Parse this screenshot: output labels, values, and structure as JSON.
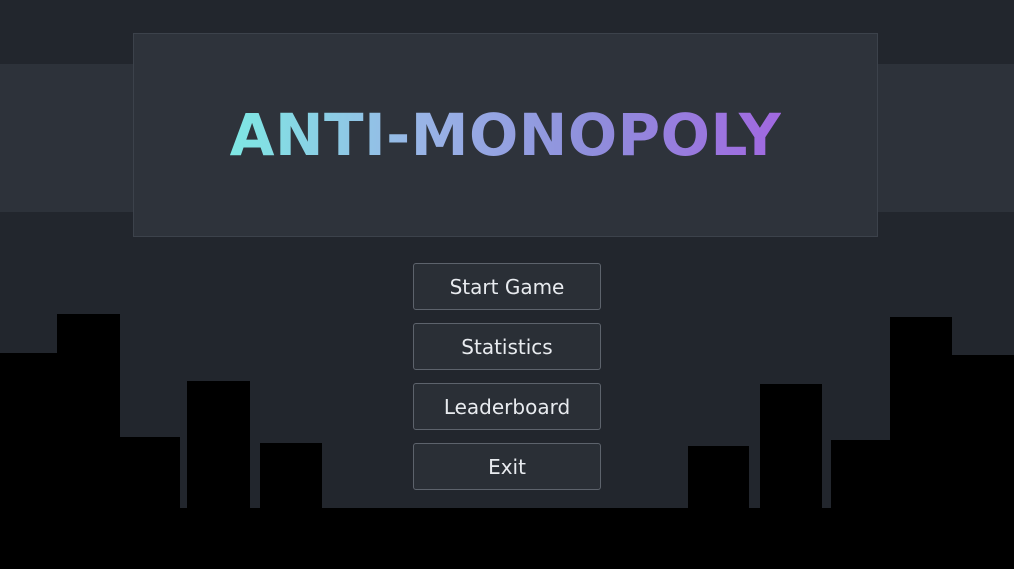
{
  "title": "ANTI-MONOPOLY",
  "menu": {
    "start_label": "Start Game",
    "statistics_label": "Statistics",
    "leaderboard_label": "Leaderboard",
    "exit_label": "Exit"
  },
  "colors": {
    "background": "#22262d",
    "band": "#2d323a",
    "panel": "#2e333b",
    "skyline": "#000000",
    "title_gradient_start": "#7ee8e4",
    "title_gradient_end": "#a168e0",
    "button_bg": "#2a2f36",
    "button_border": "#5d636c"
  }
}
